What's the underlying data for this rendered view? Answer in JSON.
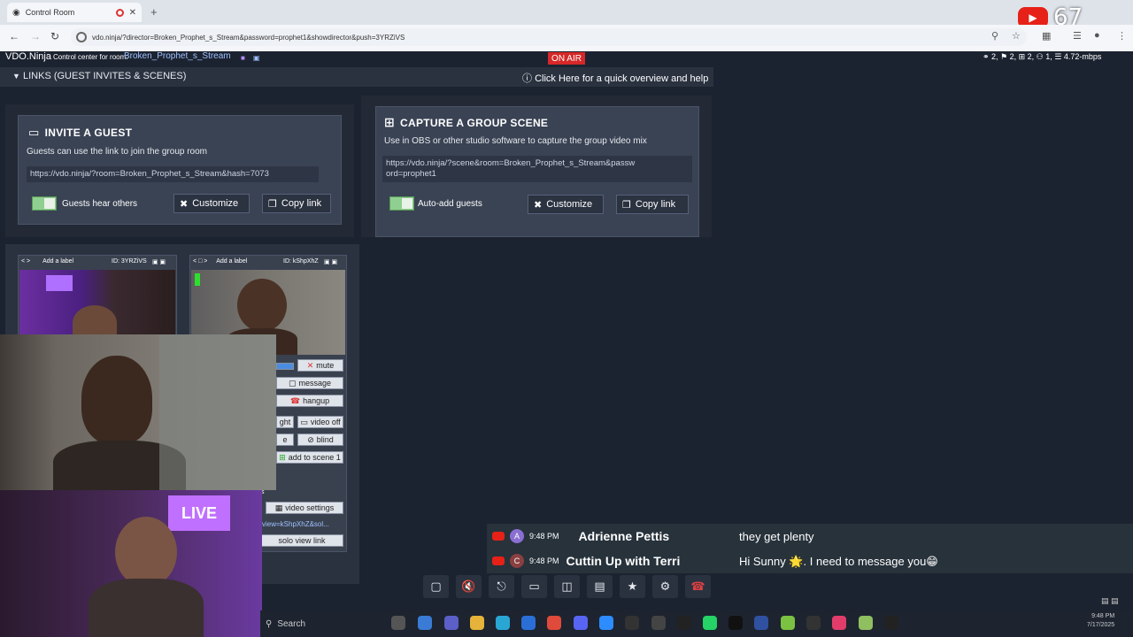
{
  "browser": {
    "tab_title": "Control Room",
    "url": "vdo.ninja/?director=Broken_Prophet_s_Stream&password=prophet1&showdirector&push=3YRZiVS",
    "youtube_count": "67"
  },
  "header": {
    "brand": "VDO.Ninja",
    "control_center_label": "Control center for room:",
    "room_name": "Broken_Prophet_s_Stream",
    "on_air": "ON AIR",
    "stats": "⚭ 2, ⚑ 2, ⊞ 2, ⚇ 1, ☰ 4.72-mbps"
  },
  "links_bar": {
    "label": "LINKS (GUEST INVITES & SCENES)",
    "help": "Click Here for a quick overview and help"
  },
  "invite": {
    "title": "INVITE A GUEST",
    "desc": "Guests can use the link to join the group room",
    "link": "https://vdo.ninja/?room=Broken_Prophet_s_Stream&hash=7073",
    "toggle_label": "Guests hear others",
    "customize": "Customize",
    "copy": "Copy link"
  },
  "scene": {
    "title": "CAPTURE A GROUP SCENE",
    "desc": "Use in OBS or other studio software to capture the group video mix",
    "link_line1": "https://vdo.ninja/?scene&room=Broken_Prophet_s_Stream&passw",
    "link_line2": "ord=prophet1",
    "toggle_label": "Auto-add guests",
    "customize": "Customize",
    "copy": "Copy link"
  },
  "guests": [
    {
      "label": "Add a label",
      "id": "ID: 3YRZiVS"
    },
    {
      "label": "Add a label",
      "id": "ID: kShpXhZ"
    }
  ],
  "guest_controls": {
    "mute": "mute",
    "message": "message",
    "hangup": "hangup",
    "highlight_fragment": "ght",
    "video_off": "video off",
    "e_fragment": "e",
    "blind": "blind",
    "add_scene": "add to scene 1",
    "video_settings": "video settings",
    "solo_link_text": "view=kShpXhZ&sol...",
    "solo_view": "solo view link",
    "s_fragment": "s"
  },
  "overlay": {
    "live_badge": "LIVE"
  },
  "chat": [
    {
      "time": "9:48 PM",
      "avatar": "A",
      "name": "Adrienne Pettis",
      "message": "they get plenty"
    },
    {
      "time": "9:48 PM",
      "avatar": "C",
      "name": "Cuttin Up with Terri",
      "message": "Hi Sunny 🌟. I need to message you😁"
    }
  ],
  "taskbar": {
    "search": "Search",
    "time": "9:48 PM",
    "date": "7/17/2025"
  }
}
